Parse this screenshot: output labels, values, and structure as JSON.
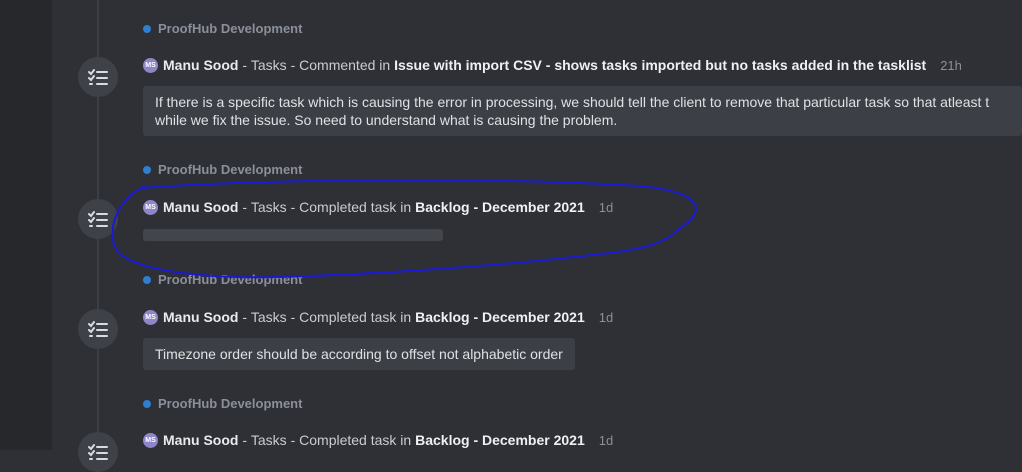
{
  "activity": [
    {
      "project": "ProofHub Development",
      "avatar_initials": "MS",
      "user": "Manu Sood",
      "separator1": " - ",
      "module": "Tasks",
      "separator2": " - ",
      "action": "Commented in ",
      "target": "Issue with import CSV - shows tasks imported but no tasks added in the tasklist",
      "time": "21h",
      "comment_line1": "If there is a specific task which is causing the error in processing, we should tell the client to remove that particular task so that atleast t",
      "comment_line2": "while we fix the issue. So need to understand what is causing the problem."
    },
    {
      "project": "ProofHub Development",
      "avatar_initials": "MS",
      "user": "Manu Sood",
      "separator1": " - ",
      "module": "Tasks",
      "separator2": " - ",
      "action": "Completed task in ",
      "target": "Backlog - December 2021",
      "time": "1d"
    },
    {
      "project": "ProofHub Development",
      "avatar_initials": "MS",
      "user": "Manu Sood",
      "separator1": " - ",
      "module": "Tasks",
      "separator2": " - ",
      "action": "Completed task in ",
      "target": "Backlog - December 2021",
      "time": "1d",
      "comment": "Timezone order should be according to offset not alphabetic order"
    },
    {
      "project": "ProofHub Development",
      "avatar_initials": "MS",
      "user": "Manu Sood",
      "separator1": " - ",
      "module": "Tasks",
      "separator2": " - ",
      "action": "Completed task in ",
      "target": "Backlog - December 2021",
      "time": "1d"
    }
  ],
  "icons": {
    "timeline": "task-list-icon"
  },
  "colors": {
    "project_dot": "#2f7fd1",
    "avatar": "#8e86c8",
    "annotation": "#1a1ad6"
  }
}
